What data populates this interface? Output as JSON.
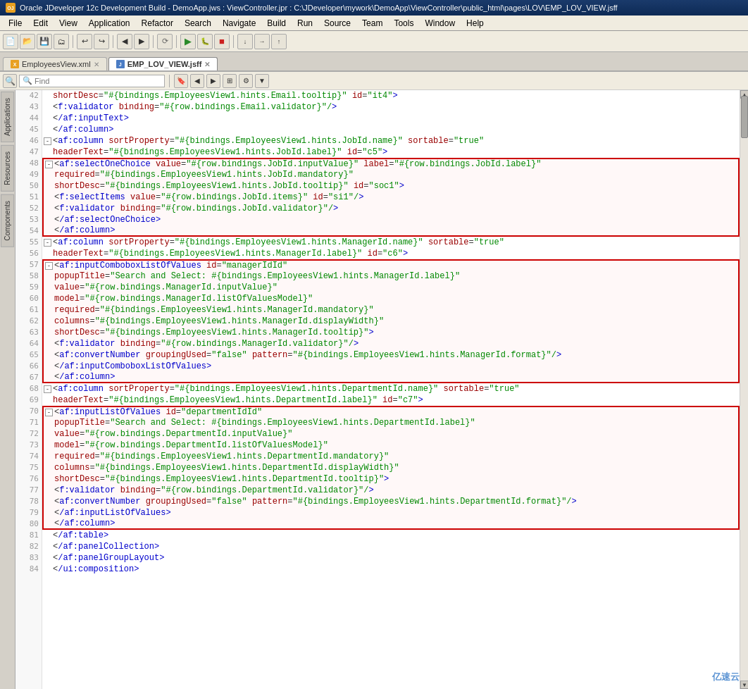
{
  "title_bar": {
    "text": "Oracle JDeveloper 12c Development Build - DemoApp.jws : ViewController.jpr : C:\\JDeveloper\\mywork\\DemoApp\\ViewController\\public_html\\pages\\LOV\\EMP_LOV_VIEW.jsff",
    "icon": "OJ"
  },
  "menu": {
    "items": [
      "File",
      "Edit",
      "View",
      "Application",
      "Refactor",
      "Search",
      "Navigate",
      "Build",
      "Run",
      "Source",
      "Team",
      "Tools",
      "Window",
      "Help"
    ]
  },
  "tabs": [
    {
      "label": "EmployeesView.xml",
      "type": "xml",
      "active": false
    },
    {
      "label": "EMP_LOV_VIEW.jsff",
      "type": "jsff",
      "active": true
    }
  ],
  "find_placeholder": "Find",
  "sidebar_tabs": [
    "Applications",
    "Resources",
    "Components"
  ],
  "watermark": "亿速云",
  "code_lines": [
    {
      "indent": 5,
      "content": "shortDesc=\"#{bindings.EmployeesView1.hints.Email.tooltip}\" id=\"it4\">"
    },
    {
      "indent": 6,
      "content": "<f:validator binding=\"#{row.bindings.Email.validator}\"/>"
    },
    {
      "indent": 5,
      "content": "</af:inputText>"
    },
    {
      "indent": 4,
      "content": "</af:column>"
    },
    {
      "indent": 3,
      "collapse": "-",
      "content": "<af:column sortProperty=\"#{bindings.EmployeesView1.hints.JobId.name}\" sortable=\"true\""
    },
    {
      "indent": 5,
      "content": "headerText=\"#{bindings.EmployeesView1.hints.JobId.label}\" id=\"c5\">"
    },
    {
      "indent": 4,
      "redbox_start": true,
      "collapse": "-",
      "content": "<af:selectOneChoice value=\"#{row.bindings.JobId.inputValue}\" label=\"#{row.bindings.JobId.label}\""
    },
    {
      "indent": 7,
      "content": "required=\"#{bindings.EmployeesView1.hints.JobId.mandatory}\""
    },
    {
      "indent": 7,
      "content": "shortDesc=\"#{bindings.EmployeesView1.hints.JobId.tooltip}\" id=\"soc1\">"
    },
    {
      "indent": 5,
      "content": "<f:selectItems value=\"#{row.bindings.JobId.items}\" id=\"si1\"/>"
    },
    {
      "indent": 5,
      "content": "<f:validator binding=\"#{row.bindings.JobId.validator}\"/>"
    },
    {
      "indent": 4,
      "content": "</af:selectOneChoice>"
    },
    {
      "indent": 4,
      "redbox_end": true,
      "content": ""
    },
    {
      "indent": 4,
      "content": "</af:column>"
    },
    {
      "indent": 3,
      "collapse": "-",
      "content": "<af:column sortProperty=\"#{bindings.EmployeesView1.hints.ManagerId.name}\" sortable=\"true\""
    },
    {
      "indent": 5,
      "content": "headerText=\"#{bindings.EmployeesView1.hints.ManagerId.label}\" id=\"c6\">"
    },
    {
      "indent": 4,
      "redbox_start": true,
      "collapse": "-",
      "content": "<af:inputComboboxListOfValues id=\"managerIdId\""
    },
    {
      "indent": 8,
      "content": "popupTitle=\"Search and Select: #{bindings.EmployeesView1.hints.ManagerId.label}\""
    },
    {
      "indent": 8,
      "content": "value=\"#{row.bindings.ManagerId.inputValue}\""
    },
    {
      "indent": 8,
      "content": "model=\"#{row.bindings.ManagerId.listOfValuesModel}\""
    },
    {
      "indent": 8,
      "content": "required=\"#{bindings.EmployeesView1.hints.ManagerId.mandatory}\""
    },
    {
      "indent": 8,
      "content": "columns=\"#{bindings.EmployeesView1.hints.ManagerId.displayWidth}\""
    },
    {
      "indent": 8,
      "content": "shortDesc=\"#{bindings.EmployeesView1.hints.ManagerId.tooltip}\">"
    },
    {
      "indent": 5,
      "content": "<f:validator binding=\"#{row.bindings.ManagerId.validator}\"/>"
    },
    {
      "indent": 5,
      "content": "<af:convertNumber groupingUsed=\"false\" pattern=\"#{bindings.EmployeesView1.hints.ManagerId.format}\"/>"
    },
    {
      "indent": 4,
      "content": "</af:inputComboboxListOfValues>"
    },
    {
      "indent": 4,
      "redbox_end": true,
      "content": ""
    },
    {
      "indent": 4,
      "content": "</af:column>"
    },
    {
      "indent": 3,
      "collapse": "-",
      "content": "<af:column sortProperty=\"#{bindings.EmployeesView1.hints.DepartmentId.name}\" sortable=\"true\""
    },
    {
      "indent": 5,
      "content": "headerText=\"#{bindings.EmployeesView1.hints.DepartmentId.label}\" id=\"c7\">"
    },
    {
      "indent": 4,
      "redbox_start": true,
      "collapse": "-",
      "content": "<af:inputListOfValues id=\"departmentIdId\""
    },
    {
      "indent": 8,
      "content": "popupTitle=\"Search and Select: #{bindings.EmployeesView1.hints.DepartmentId.label}\""
    },
    {
      "indent": 8,
      "content": "value=\"#{row.bindings.DepartmentId.inputValue}\""
    },
    {
      "indent": 8,
      "content": "model=\"#{row.bindings.DepartmentId.listOfValuesModel}\""
    },
    {
      "indent": 8,
      "content": "required=\"#{bindings.EmployeesView1.hints.DepartmentId.mandatory}\""
    },
    {
      "indent": 8,
      "content": "columns=\"#{bindings.EmployeesView1.hints.DepartmentId.displayWidth}\""
    },
    {
      "indent": 8,
      "content": "shortDesc=\"#{bindings.EmployeesView1.hints.DepartmentId.tooltip}\">"
    },
    {
      "indent": 5,
      "content": "<f:validator binding=\"#{row.bindings.DepartmentId.validator}\"/>"
    },
    {
      "indent": 5,
      "content": "<af:convertNumber groupingUsed=\"false\" pattern=\"#{bindings.EmployeesView1.hints.DepartmentId.format}\"/>"
    },
    {
      "indent": 4,
      "content": "</af:inputListOfValues>"
    },
    {
      "indent": 4,
      "redbox_end": true,
      "content": ""
    },
    {
      "indent": 4,
      "content": "</af:column>"
    },
    {
      "indent": 3,
      "content": "</af:table>"
    },
    {
      "indent": 3,
      "content": "</af:panelCollection>"
    },
    {
      "indent": 2,
      "content": "</af:panelGroupLayout>"
    },
    {
      "indent": 1,
      "content": "</ui:composition>"
    }
  ]
}
